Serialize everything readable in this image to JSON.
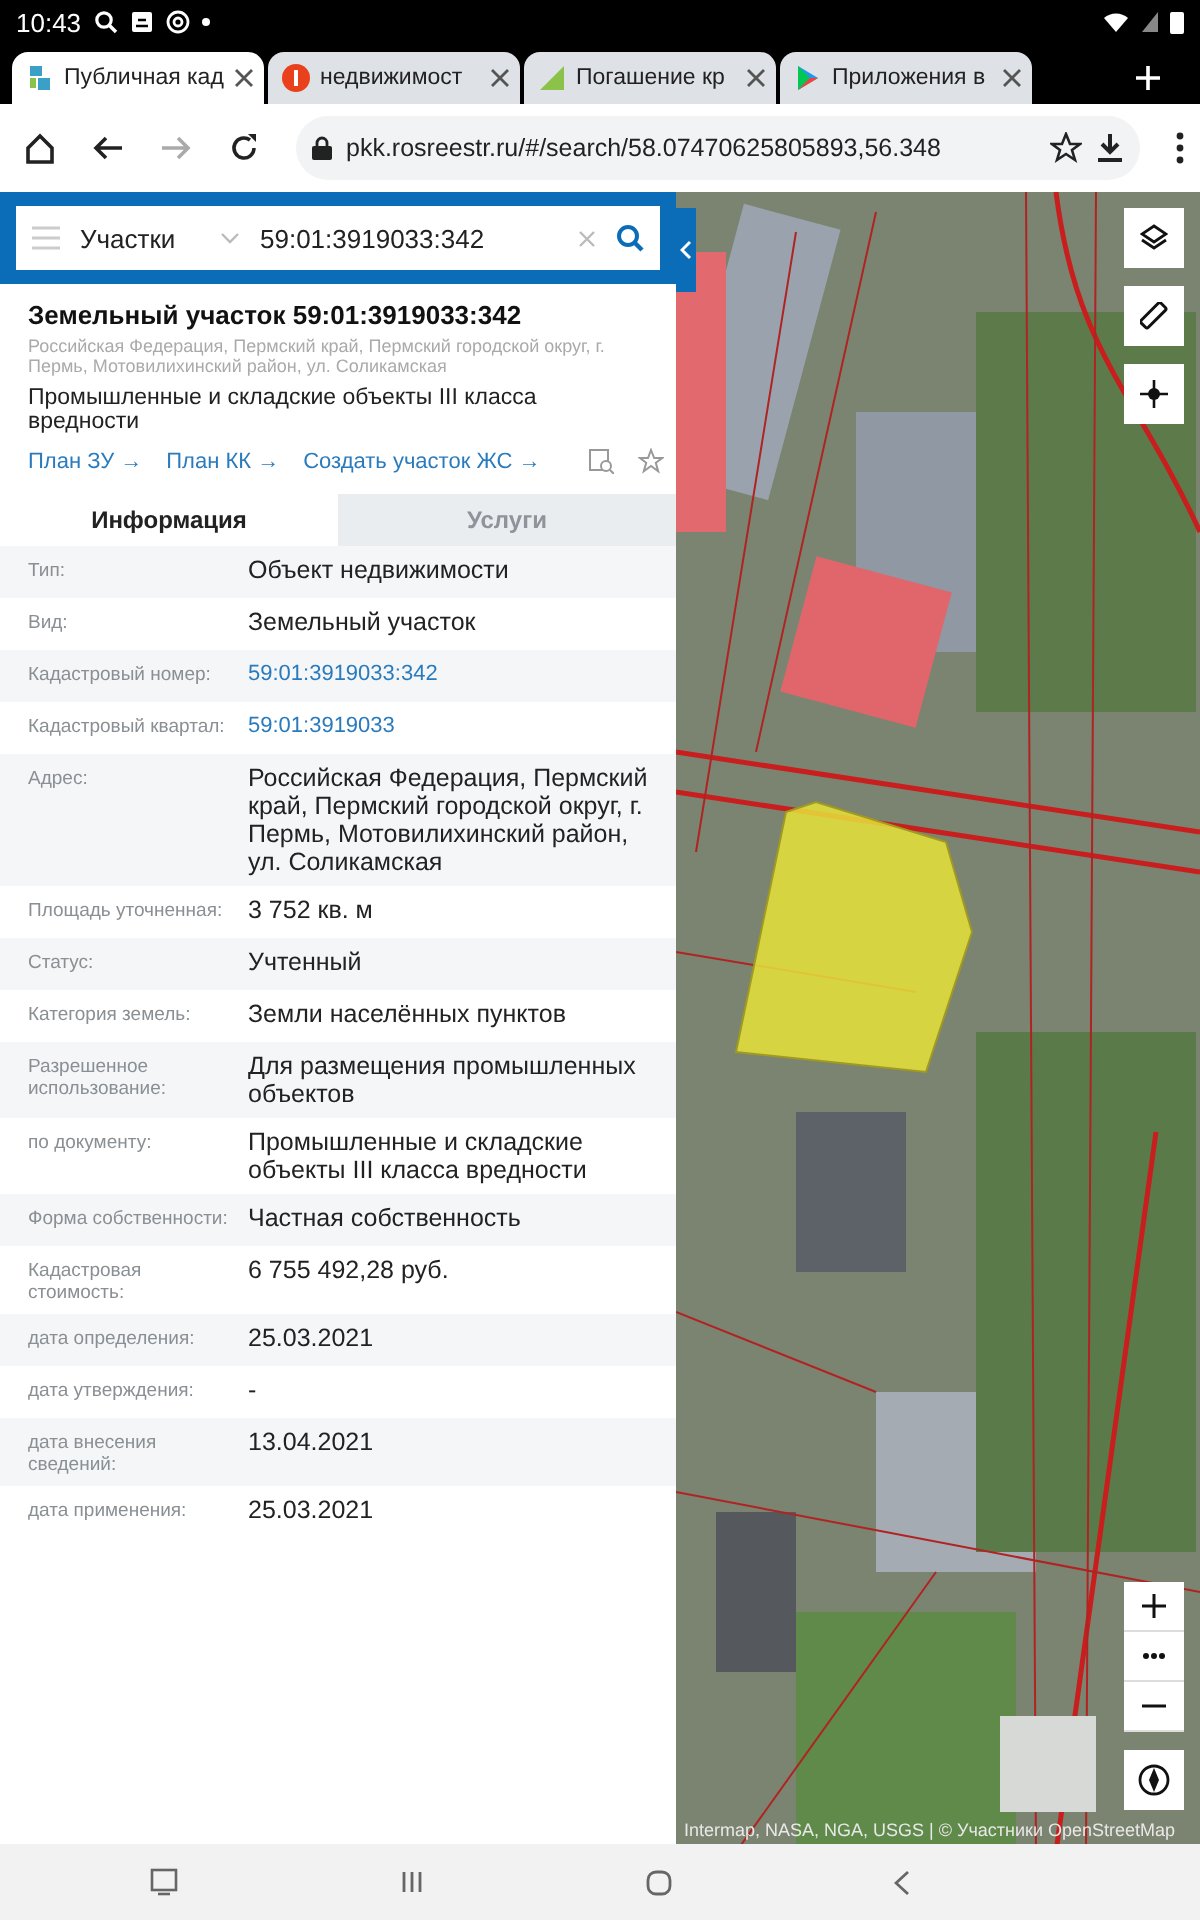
{
  "status_bar": {
    "time": "10:43"
  },
  "tabs": [
    {
      "title": "Публичная кад",
      "selected": true
    },
    {
      "title": "недвижимост",
      "selected": false
    },
    {
      "title": "Погашение кр",
      "selected": false
    },
    {
      "title": "Приложения в",
      "selected": false
    }
  ],
  "address_bar": {
    "url": "pkk.rosreestr.ru/#/search/58.07470625805893,56.348"
  },
  "search": {
    "category": "Участки",
    "value": "59:01:3919033:342"
  },
  "object": {
    "title": "Земельный участок 59:01:3919033:342",
    "address": "Российская Федерация, Пермский край, Пермский городской округ, г. Пермь, Мотовилихинский район, ул. Соликамская",
    "purpose": "Промышленные и складские объекты III класса вредности",
    "links": [
      "План ЗУ →",
      "План КК →",
      "Создать участок ЖС →"
    ]
  },
  "info_tabs": [
    {
      "label": "Информация",
      "selected": true
    },
    {
      "label": "Услуги",
      "selected": false
    }
  ],
  "rows": [
    {
      "label": "Тип:",
      "value": "Объект недвижимости",
      "kind": "text"
    },
    {
      "label": "Вид:",
      "value": "Земельный участок",
      "kind": "text"
    },
    {
      "label": "Кадастровый номер:",
      "value": "59:01:3919033:342",
      "kind": "link"
    },
    {
      "label": "Кадастровый квартал:",
      "value": "59:01:3919033",
      "kind": "link"
    },
    {
      "label": "Адрес:",
      "value": "Российская Федерация, Пермский край, Пермский городской округ, г. Пермь, Мотовилихинский район, ул. Соликамская",
      "kind": "text"
    },
    {
      "label": "Площадь уточненная:",
      "value": "3 752 кв. м",
      "kind": "text"
    },
    {
      "label": "Статус:",
      "value": "Учтенный",
      "kind": "text"
    },
    {
      "label": "Категория земель:",
      "value": "Земли населённых пунктов",
      "kind": "text"
    },
    {
      "label": "Разрешенное использование:",
      "value": "Для размещения промышленных объектов",
      "kind": "text"
    },
    {
      "label": "по документу:",
      "value": "Промышленные и складские объекты III класса вредности",
      "kind": "text"
    },
    {
      "label": "Форма собственности:",
      "value": "Частная собственность",
      "kind": "text"
    },
    {
      "label": "Кадастровая стоимость:",
      "value": "6 755 492,28 руб.",
      "kind": "text"
    },
    {
      "label": "дата определения:",
      "value": "25.03.2021",
      "kind": "text"
    },
    {
      "label": "дата утверждения:",
      "value": "-",
      "kind": "text"
    },
    {
      "label": "дата внесения сведений:",
      "value": "13.04.2021",
      "kind": "text"
    },
    {
      "label": "дата применения:",
      "value": "25.03.2021",
      "kind": "text"
    }
  ],
  "map": {
    "attribution": "Intermap, NASA, NGA, USGS | © Участники OpenStreetMap"
  }
}
